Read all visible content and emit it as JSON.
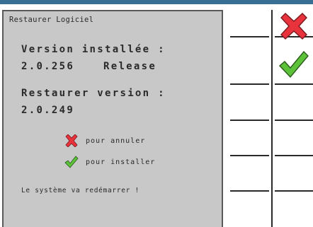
{
  "dialog": {
    "title": "Restaurer Logiciel",
    "installed_label": "Version installée :",
    "installed_version": "2.0.256",
    "installed_type": "Release",
    "restore_label": "Restaurer version :",
    "restore_version": "2.0.249",
    "cancel_hint": "pour annuler",
    "install_hint": "pour installer",
    "reboot_notice": "Le système va redémarrer !"
  },
  "softkeys": [
    {
      "icon": "cancel-x-icon",
      "color": "#e8323c"
    },
    {
      "icon": "confirm-check-icon",
      "color": "#5cc23a"
    },
    {
      "icon": "empty"
    },
    {
      "icon": "empty"
    },
    {
      "icon": "empty"
    },
    {
      "icon": "empty"
    }
  ],
  "colors": {
    "dialog_bg": "#c8c8c8",
    "accent_bar": "#3a6f95",
    "cancel": "#e8323c",
    "confirm": "#5cc23a"
  }
}
